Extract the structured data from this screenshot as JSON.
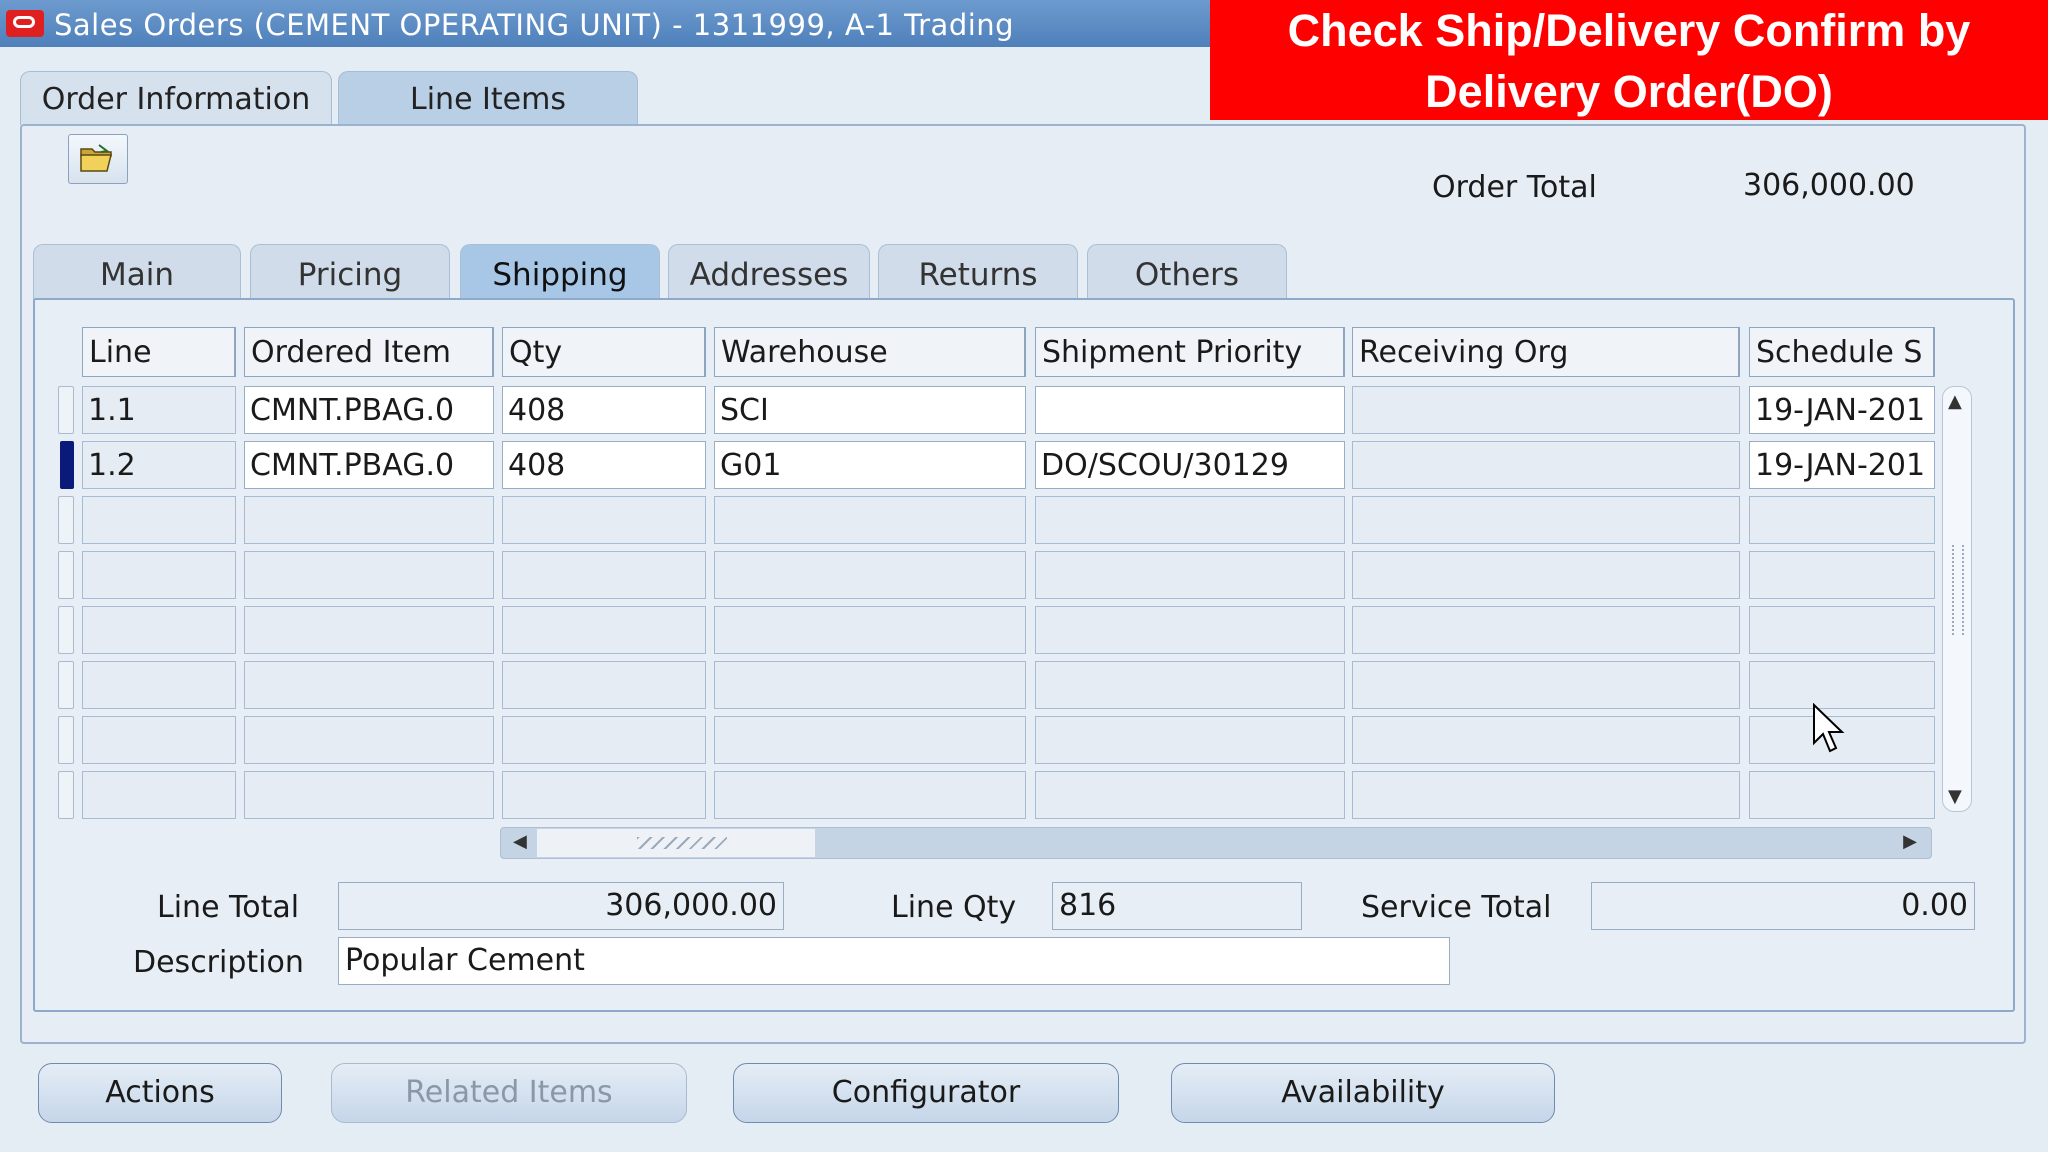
{
  "window": {
    "title": "Sales Orders (CEMENT OPERATING UNIT) - 1311999, A-1 Trading"
  },
  "banner": {
    "line1": "Check Ship/Delivery Confirm by",
    "line2": "Delivery Order(DO)",
    "color": "#ff0000"
  },
  "outer_tabs": [
    {
      "label": "Order Information",
      "active": false
    },
    {
      "label": "Line Items",
      "active": true
    }
  ],
  "toolbar": {
    "open_icon": "folder-open-icon"
  },
  "order_total": {
    "label": "Order Total",
    "value": "306,000.00"
  },
  "inner_tabs": [
    {
      "label": "Main"
    },
    {
      "label": "Pricing"
    },
    {
      "label": "Shipping",
      "active": true
    },
    {
      "label": "Addresses"
    },
    {
      "label": "Returns"
    },
    {
      "label": "Others"
    }
  ],
  "table": {
    "columns": [
      "Line",
      "Ordered Item",
      "Qty",
      "Warehouse",
      "Shipment Priority",
      "Receiving Org",
      "Schedule S"
    ],
    "rows": [
      {
        "line": "1.1",
        "item": "CMNT.PBAG.0",
        "qty": "408",
        "warehouse": "SCI",
        "priority": "",
        "receiving_org": "",
        "schedule": "19-JAN-201"
      },
      {
        "line": "1.2",
        "item": "CMNT.PBAG.0",
        "qty": "408",
        "warehouse": "G01",
        "priority": "DO/SCOU/30129",
        "receiving_org": "",
        "schedule": "19-JAN-201"
      }
    ]
  },
  "summary": {
    "line_total_label": "Line Total",
    "line_total": "306,000.00",
    "line_qty_label": "Line Qty",
    "line_qty": "816",
    "service_total_label": "Service Total",
    "service_total": "0.00",
    "description_label": "Description",
    "description": "Popular Cement"
  },
  "buttons": {
    "actions": "Actions",
    "related_items": "Related Items",
    "configurator": "Configurator",
    "availability": "Availability"
  }
}
